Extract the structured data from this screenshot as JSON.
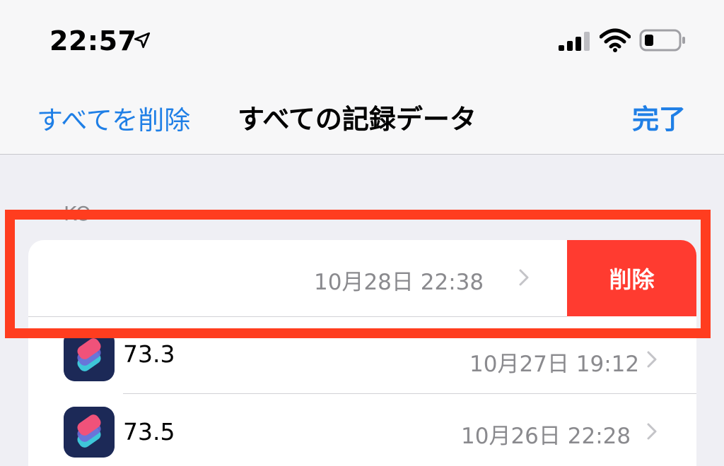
{
  "status_bar": {
    "time": "22:57",
    "location_icon": "location-arrow-icon",
    "signal_icon": "cellular-signal-icon",
    "wifi_icon": "wifi-icon",
    "battery_icon": "battery-low-icon"
  },
  "nav": {
    "left_label": "すべてを削除",
    "title": "すべての記録データ",
    "right_label": "完了"
  },
  "section": {
    "header": "KO"
  },
  "rows": [
    {
      "value": "",
      "date": "10月28日 22:38",
      "swipe_action": "削除"
    },
    {
      "value": "73.3",
      "date": "10月27日 19:12"
    },
    {
      "value": "73.5",
      "date": "10月26日 22:28"
    }
  ],
  "colors": {
    "accent": "#1f7fe6",
    "delete": "#ff3b30",
    "highlight": "#ff3d1f",
    "app_icon_bg": "#1c2957"
  }
}
